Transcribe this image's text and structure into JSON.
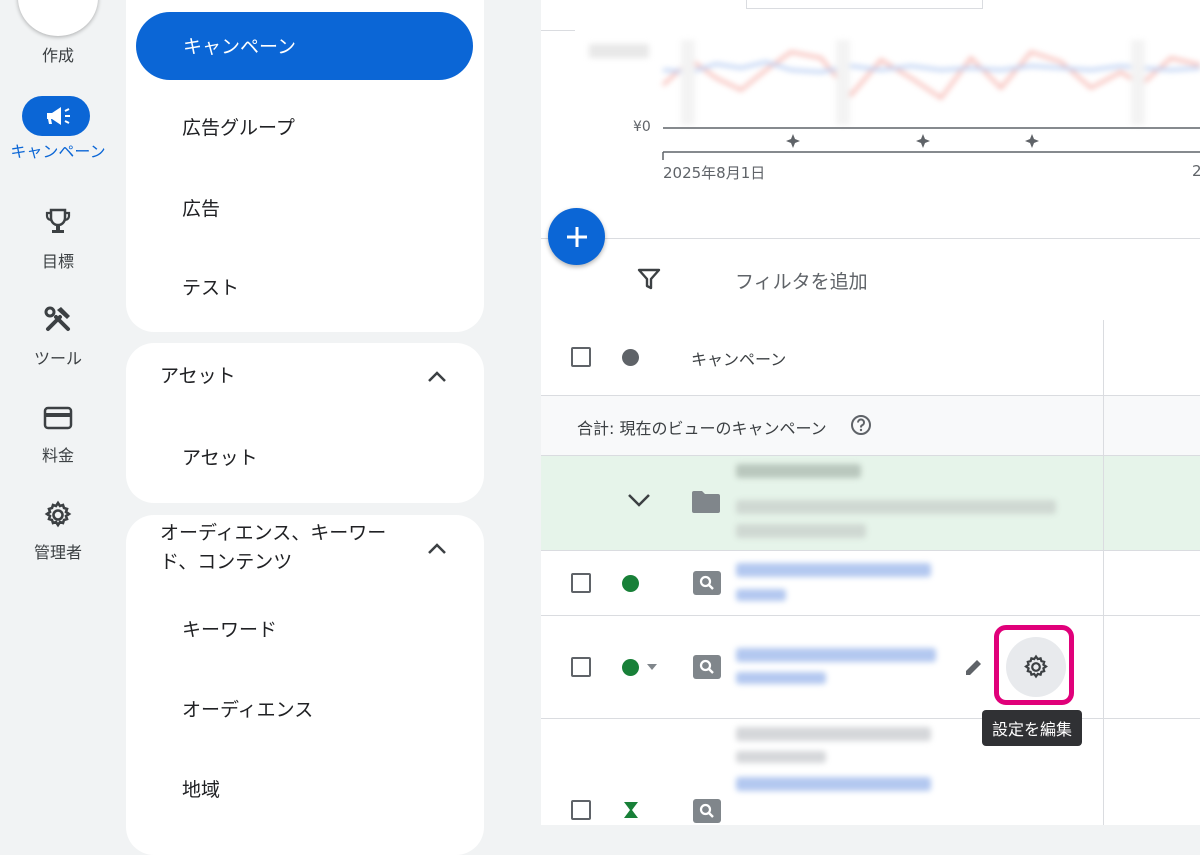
{
  "rail": {
    "create_label": "作成",
    "items": [
      {
        "label": "キャンペーン",
        "icon": "megaphone-icon",
        "active": true
      },
      {
        "label": "目標",
        "icon": "trophy-icon"
      },
      {
        "label": "ツール",
        "icon": "tools-icon"
      },
      {
        "label": "料金",
        "icon": "credit-card-icon"
      },
      {
        "label": "管理者",
        "icon": "gear-icon"
      }
    ]
  },
  "nav": {
    "campaigns_group": [
      "キャンペーン",
      "広告グループ",
      "広告",
      "テスト"
    ],
    "assets_section": {
      "title": "アセット",
      "items": [
        "アセット"
      ]
    },
    "audience_section": {
      "title": "オーディエンス、キーワード、コンテンツ",
      "items": [
        "キーワード",
        "オーディエンス",
        "地域"
      ]
    }
  },
  "chart": {
    "y_axis_zero_label": "¥0",
    "x_start_label": "2025年8月1日",
    "x_end_label_partial": "2",
    "colors": {
      "series_red": "#f28b82",
      "series_blue": "#8ab4f8",
      "accent": "#0b66d6"
    }
  },
  "toolbar": {
    "filter_placeholder": "フィルタを追加"
  },
  "table": {
    "header_label": "キャンペーン",
    "summary_label": "合計: 現在のビューのキャンペーン",
    "status_colors": {
      "enabled": "#188038",
      "header_dot": "#5f6368",
      "group_row_bg": "#e6f4ea"
    }
  },
  "tooltip": {
    "text": "設定を編集"
  },
  "colors": {
    "highlight": "#e0007a"
  }
}
